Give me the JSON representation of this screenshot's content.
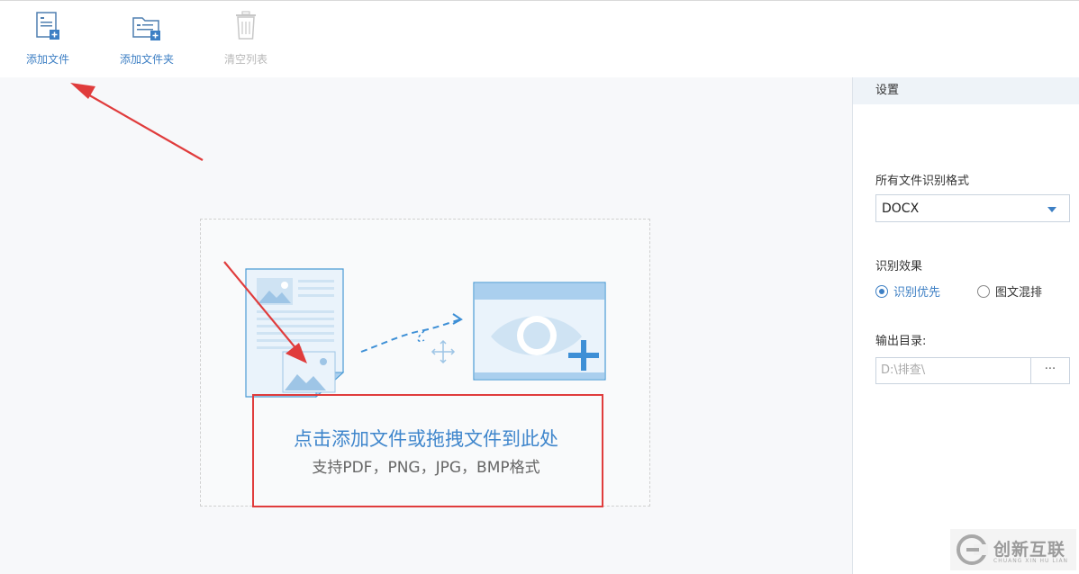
{
  "toolbar": {
    "add_file": "添加文件",
    "add_folder": "添加文件夹",
    "clear_list": "清空列表"
  },
  "dropzone": {
    "title": "点击添加文件或拖拽文件到此处",
    "subtitle": "支持PDF，PNG，JPG，BMP格式"
  },
  "settings": {
    "header": "设置",
    "format_label": "所有文件识别格式",
    "format_value": "DOCX",
    "effect_label": "识别效果",
    "effect_options": [
      "识别优先",
      "图文混排"
    ],
    "effect_selected": "识别优先",
    "output_label": "输出目录:",
    "output_value": "D:\\排查\\",
    "browse_label": "···"
  },
  "watermark": {
    "text": "创新互联",
    "sub": "CHUANG XIN HU LIAN"
  },
  "colors": {
    "accent": "#3d7fc4",
    "annotation": "#e03c3c"
  }
}
